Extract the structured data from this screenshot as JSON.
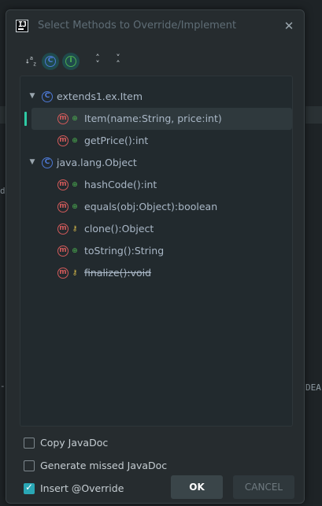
{
  "background": {
    "left_fragment": "d",
    "right_fragment": "DEA",
    "left_fragment2": "-"
  },
  "dialog": {
    "title": "Select Methods to Override/Implement",
    "icon_text": "IJ",
    "close_symbol": "✕"
  },
  "toolbar": {
    "sort_icon": "↓a z",
    "show_classes_icon": "C",
    "show_interfaces_icon": "I",
    "expand_icon": "expand-all",
    "collapse_icon": "collapse-all"
  },
  "tree": {
    "groups": [
      {
        "class_name": "extends1.ex.Item",
        "methods": [
          {
            "signature": "Item(name:String, price:int)",
            "visibility": "public",
            "selected": true,
            "deprecated": false
          },
          {
            "signature": "getPrice():int",
            "visibility": "public",
            "selected": false,
            "deprecated": false
          }
        ]
      },
      {
        "class_name": "java.lang.Object",
        "methods": [
          {
            "signature": "hashCode():int",
            "visibility": "public",
            "selected": false,
            "deprecated": false
          },
          {
            "signature": "equals(obj:Object):boolean",
            "visibility": "public",
            "selected": false,
            "deprecated": false
          },
          {
            "signature": "clone():Object",
            "visibility": "protected",
            "selected": false,
            "deprecated": false
          },
          {
            "signature": "toString():String",
            "visibility": "public",
            "selected": false,
            "deprecated": false
          },
          {
            "signature": "finalize():void",
            "visibility": "protected",
            "selected": false,
            "deprecated": true
          }
        ]
      }
    ]
  },
  "options": {
    "copy_javadoc": {
      "label": "Copy JavaDoc",
      "checked": false
    },
    "generate_missed_javadoc": {
      "label": "Generate missed JavaDoc",
      "checked": false
    },
    "insert_override": {
      "label": "Insert @Override",
      "checked": true
    }
  },
  "buttons": {
    "ok": "OK",
    "cancel": "CANCEL"
  },
  "colors": {
    "accent": "#2aa7b5",
    "class_icon": "#4d79d6",
    "method_icon": "#d25a5a",
    "public": "#4caf50",
    "protected": "#d4b74a"
  }
}
